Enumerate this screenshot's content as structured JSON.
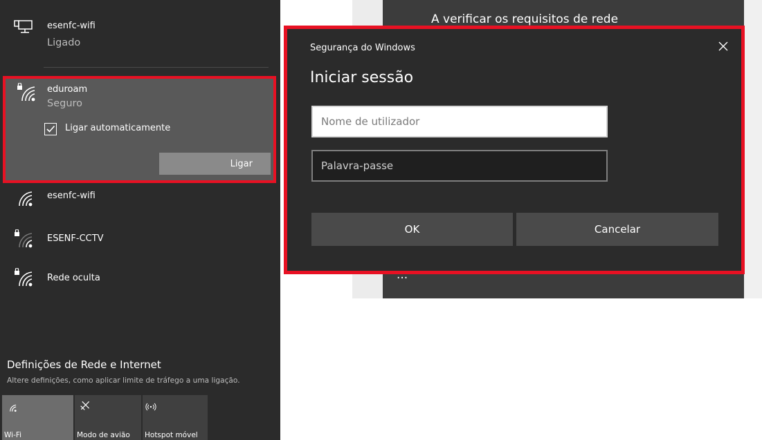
{
  "flyout": {
    "connected": {
      "name": "esenfc-wifi",
      "status": "Ligado",
      "icon": "ethernet-computer-icon"
    },
    "selected": {
      "name": "eduroam",
      "status": "Seguro",
      "icon": "secured-wifi-icon",
      "auto_connect_label": "Ligar automaticamente",
      "auto_connect_checked": true,
      "connect_label": "Ligar"
    },
    "networks": [
      {
        "name": "esenfc-wifi",
        "secured": false,
        "icon": "wifi-icon"
      },
      {
        "name": "ESENF-CCTV",
        "secured": true,
        "icon": "secured-wifi-weak-icon"
      },
      {
        "name": "Rede oculta",
        "secured": true,
        "icon": "secured-wifi-icon"
      }
    ],
    "settings": {
      "title": "Definições de Rede e Internet",
      "subtitle": "Altere definições, como aplicar limite de tráfego a uma ligação."
    },
    "quick_actions": [
      {
        "label": "Wi-Fi",
        "active": true,
        "icon": "wifi-icon"
      },
      {
        "label": "Modo de avião",
        "active": false,
        "icon": "airplane-icon"
      },
      {
        "label": "Hotspot móvel",
        "active": false,
        "icon": "hotspot-icon"
      }
    ]
  },
  "background_window": {
    "title": "A verificar os requisitos de rede",
    "dots": "..."
  },
  "dialog": {
    "caption": "Segurança do Windows",
    "heading": "Iniciar sessão",
    "username_placeholder": "Nome de utilizador",
    "password_placeholder": "Palavra-passe",
    "ok_label": "OK",
    "cancel_label": "Cancelar"
  },
  "colors": {
    "highlight": "#e81123",
    "flyout_bg": "#2b2b2b",
    "selected_bg": "#595959"
  }
}
